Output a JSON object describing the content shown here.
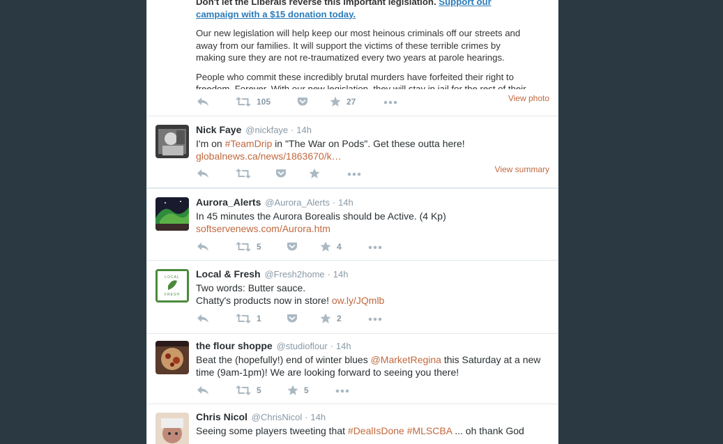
{
  "top_tweet": {
    "card_bold_line": "Don't let the Liberals reverse this important legislation.",
    "card_link_text": "Support our campaign with a $15 donation today.",
    "card_paragraph_1": "Our new legislation will help keep our most heinous criminals off our streets and away from our families. It will support the victims of these terrible crimes by making sure they are not re-traumatized every two years at parole hearings.",
    "card_paragraph_2": "People who commit these incredibly brutal murders have forfeited their right to freedom. Forever. With our new legislation, they will stay in jail for the rest of their",
    "retweets": "105",
    "likes": "27",
    "view_label": "View photo"
  },
  "tweets": [
    {
      "fullname": "Nick Faye",
      "username": "@nickfaye",
      "time": "14h",
      "text_1": "I'm on ",
      "hashtag": "#TeamDrip",
      "text_2": " in \"The War on Pods\". Get these outta here!",
      "url": "globalnews.ca/news/1863670/k…",
      "view_label": "View summary"
    },
    {
      "fullname": "Aurora_Alerts",
      "username": "@Aurora_Alerts",
      "time": "14h",
      "line_1": "In 45 minutes the Aurora Borealis should be Active. (4 Kp)",
      "url": "softservenews.com/Aurora.htm",
      "retweets": "5",
      "likes": "4"
    },
    {
      "fullname": "Local & Fresh",
      "username": "@Fresh2home",
      "time": "14h",
      "line_1": "Two words: Butter sauce.",
      "line_2": "Chatty's products now in store! ",
      "url": "ow.ly/JQmlb",
      "retweets": "1",
      "likes": "2",
      "avatar_text_top": "LOCAL",
      "avatar_text_bottom": "FRESH"
    },
    {
      "fullname": "the flour shoppe",
      "username": "@studioflour",
      "time": "14h",
      "text_1": "Beat the (hopefully!) end of winter blues ",
      "mention": "@MarketRegina",
      "text_2": " this Saturday at a new time (9am-1pm)! We are looking forward to seeing you there!",
      "retweets": "5",
      "likes": "5"
    },
    {
      "fullname": "Chris Nicol",
      "username": "@ChrisNicol",
      "time": "14h",
      "text_1": "Seeing some players tweeting that ",
      "hashtag_1": "#DealIsDone",
      "hashtag_2": "#MLSCBA",
      "text_2": " ... oh thank God"
    }
  ],
  "separator": "·",
  "colors": {
    "link": "#c0683e",
    "background": "#2b3a42",
    "icon": "#aab8c2"
  }
}
